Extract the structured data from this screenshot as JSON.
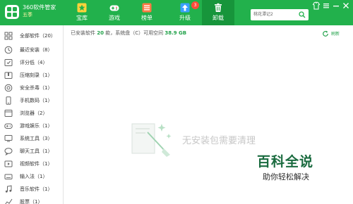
{
  "app": {
    "name": "360软件管家",
    "edition": "五季"
  },
  "tabs": [
    {
      "label": "宝库",
      "icon": "star-icon"
    },
    {
      "label": "游戏",
      "icon": "gamepad-icon"
    },
    {
      "label": "榜单",
      "icon": "ranking-icon"
    },
    {
      "label": "升级",
      "icon": "upgrade-icon",
      "badge": "3"
    },
    {
      "label": "卸载",
      "icon": "trash-icon",
      "active": true
    }
  ],
  "search": {
    "placeholder": "桃花潭记2"
  },
  "sidebar": {
    "items": [
      {
        "label": "全部软件（20）",
        "icon": "grid-icon"
      },
      {
        "label": "最近安装（8）",
        "icon": "clock-icon"
      },
      {
        "label": "评分低（4）",
        "icon": "rating-icon"
      },
      {
        "label": "压缩刻录（1）",
        "icon": "archive-icon"
      },
      {
        "label": "安全杀毒（1）",
        "icon": "shield-icon"
      },
      {
        "label": "手机数码（1）",
        "icon": "phone-icon"
      },
      {
        "label": "浏览器（2）",
        "icon": "browser-icon"
      },
      {
        "label": "游戏娱乐（1）",
        "icon": "gamepad-icon"
      },
      {
        "label": "系统工具（3）",
        "icon": "tools-icon"
      },
      {
        "label": "聊天工具（1）",
        "icon": "chat-icon"
      },
      {
        "label": "视频软件（1）",
        "icon": "video-icon"
      },
      {
        "label": "输入法（1）",
        "icon": "keyboard-icon"
      },
      {
        "label": "音乐软件（1）",
        "icon": "music-icon"
      },
      {
        "label": "股票（1）",
        "icon": "stock-icon"
      }
    ]
  },
  "status": {
    "prefix": "已安装软件",
    "count": "20",
    "middle": "款，系统盘（C）可用空间",
    "free_space": "38.9 GB"
  },
  "refresh_label": "刷新",
  "empty_message": "无安装包需要清理",
  "watermark": {
    "line1": "百科全说",
    "line2": "助你轻松解决"
  },
  "colors": {
    "header_green": "#22b14c",
    "active_tab": "#17953b",
    "accent_green": "#22a24a"
  }
}
